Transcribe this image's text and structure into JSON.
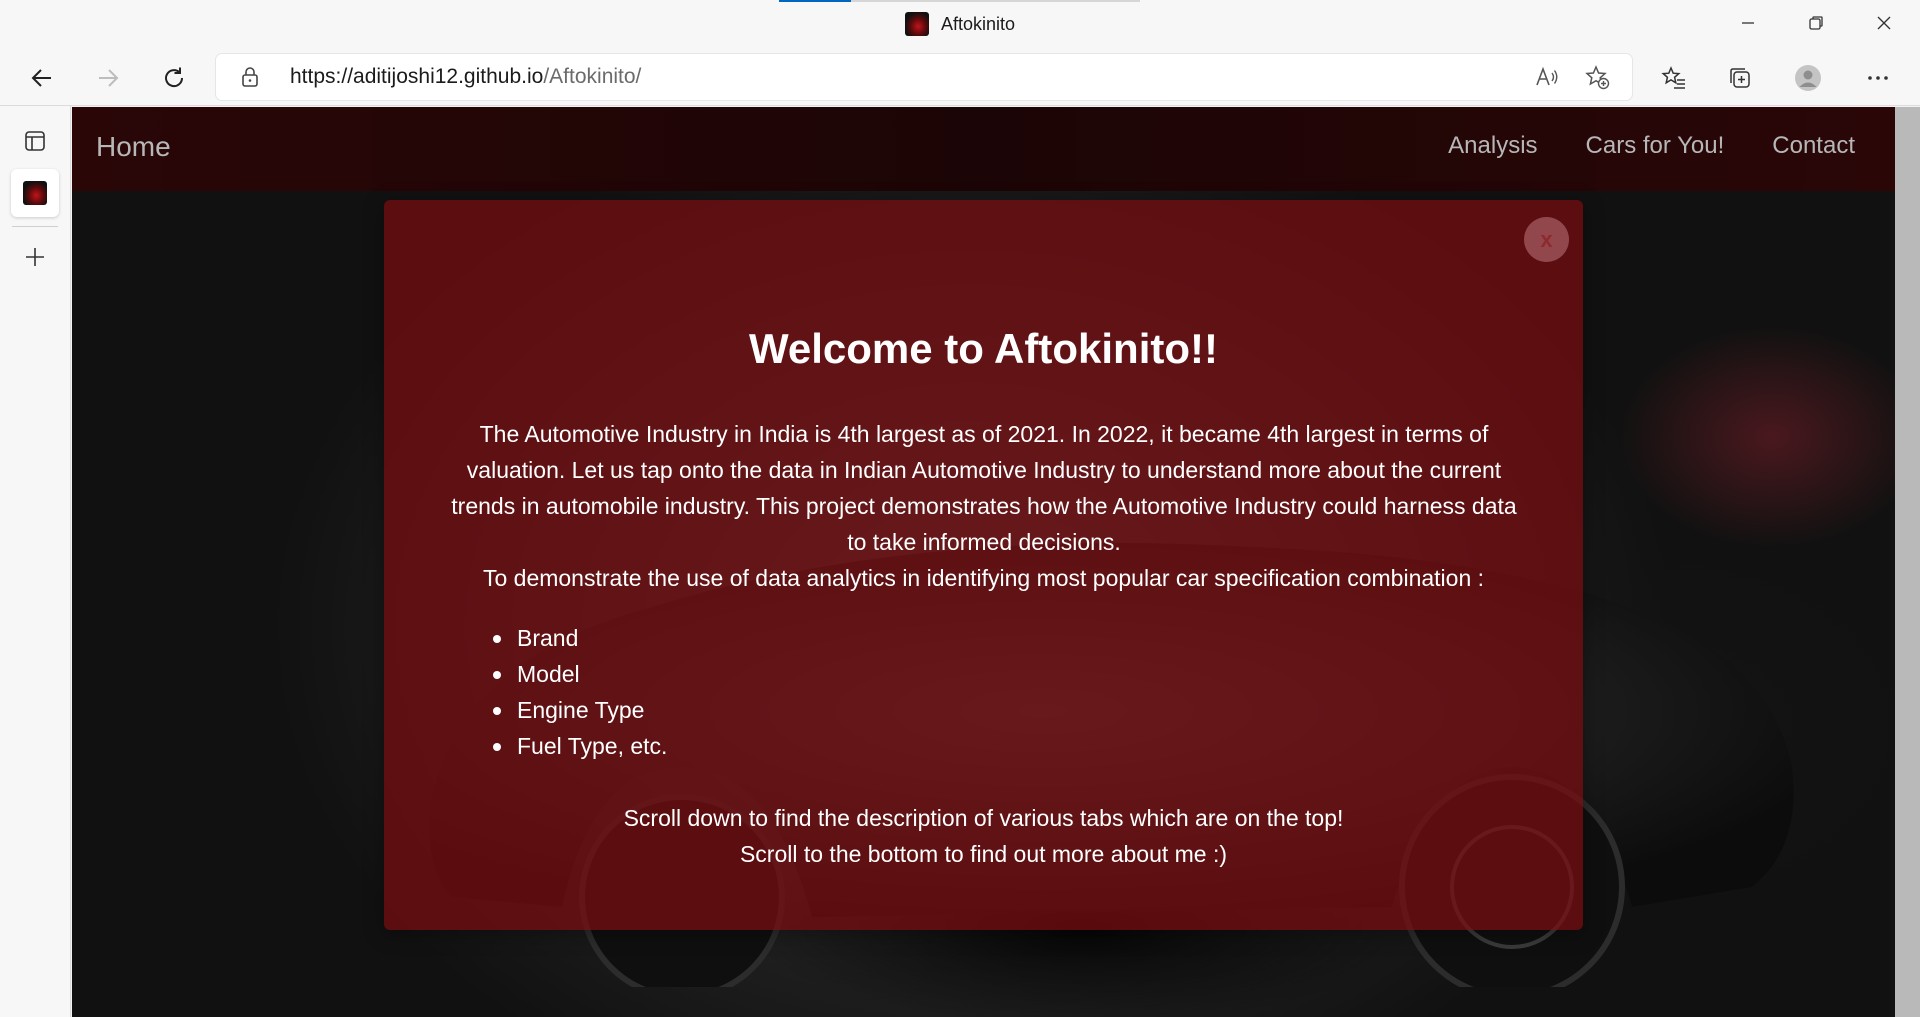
{
  "window": {
    "title": "Aftokinito",
    "icons": [
      "minimize-icon",
      "restore-icon",
      "close-icon"
    ]
  },
  "toolbar": {
    "url_host": "https://aditijoshi12.github.io",
    "url_path": "/Aftokinito/",
    "icons": [
      "back-icon",
      "forward-icon",
      "refresh-icon",
      "lock-icon",
      "read-aloud-icon",
      "add-favorite-icon",
      "favorites-icon",
      "collections-icon",
      "profile-avatar",
      "more-icon"
    ]
  },
  "sidebar": {
    "icons": [
      "tab-actions-icon",
      "site-favicon",
      "new-tab-icon"
    ]
  },
  "navbar": {
    "brand": "Home",
    "links": [
      "Analysis",
      "Cars for You!",
      "Contact"
    ]
  },
  "modal": {
    "close_label": "x",
    "title": "Welcome to Aftokinito!!",
    "intro": "The Automotive Industry in India is 4th largest as of 2021. In 2022, it became 4th largest in terms of valuation. Let us tap onto the data in Indian Automotive Industry to understand more about the current trends in automobile industry. This project demonstrates how the Automotive Industry could harness data to take informed decisions.",
    "purpose": "To demonstrate the use of data analytics in identifying most popular car specification combination :",
    "list": [
      "Brand",
      "Model",
      "Engine Type",
      "Fuel Type, etc."
    ],
    "outro_1": "Scroll down to find the description of various tabs which are on the top!",
    "outro_2": "Scroll to the bottom to find out more about me :)"
  },
  "colors": {
    "modal_bg": "#780c10",
    "navbar_bg": "#1c0506",
    "nav_text": "#b7b7b7",
    "browser_accent": "#0067c0"
  }
}
